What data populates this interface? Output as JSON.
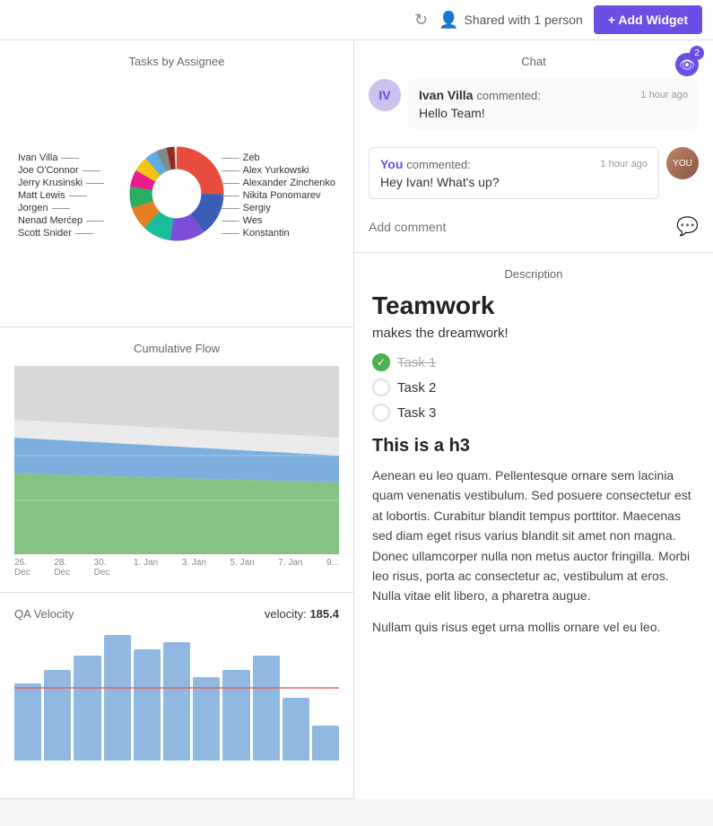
{
  "header": {
    "shared_label": "Shared with 1 person",
    "add_widget_label": "+ Add Widget"
  },
  "tasks_by_assignee": {
    "title": "Tasks by Assignee",
    "labels_left": [
      "Ivan Villa",
      "Joe O'Connor",
      "Jerry Krusinski",
      "Matt Lewis",
      "Jorgen",
      "Nenad Merćep",
      "Scott Snider"
    ],
    "labels_right": [
      "Zeb",
      "Alex Yurkowski",
      "Alexander Zinchenko",
      "Nikita Ponomarev",
      "Sergiy",
      "Wes",
      "Konstantin"
    ]
  },
  "cumulative_flow": {
    "title": "Cumulative Flow",
    "x_labels": [
      "26.\nDec",
      "28.\nDec",
      "30.\nDec",
      "1. Jan",
      "3. Jan",
      "5. Jan",
      "7. Jan",
      "9..."
    ]
  },
  "qa_velocity": {
    "title": "QA Velocity",
    "velocity_label": "velocity:",
    "velocity_value": "185.4",
    "bar_heights": [
      55,
      65,
      75,
      90,
      80,
      85,
      60,
      65,
      75,
      45,
      25
    ],
    "avg_line_pct": 55
  },
  "chat": {
    "title": "Chat",
    "eye_count": "2",
    "messages": [
      {
        "author": "Ivan Villa",
        "time": "1 hour ago",
        "text": "Hello Team!"
      }
    ],
    "you_message": {
      "author": "You",
      "commented": "commented:",
      "time": "1 hour ago",
      "text": "Hey Ivan! What's up?"
    },
    "add_comment_placeholder": "Add comment"
  },
  "description": {
    "label": "Description",
    "title": "Teamwork",
    "subtitle": "makes the dreamwork!",
    "tasks": [
      {
        "label": "Task 1",
        "done": true
      },
      {
        "label": "Task 2",
        "done": false
      },
      {
        "label": "Task 3",
        "done": false
      }
    ],
    "h3": "This is a h3",
    "body1": "Aenean eu leo quam. Pellentesque ornare sem lacinia quam venenatis vestibulum. Sed posuere consectetur est at lobortis. Curabitur blandit tempus porttitor. Maecenas sed diam eget risus varius blandit sit amet non magna. Donec ullamcorper nulla non metus auctor fringilla. Morbi leo risus, porta ac consectetur ac, vestibulum at eros. Nulla vitae elit libero, a pharetra augue.",
    "body2": "Nullam quis risus eget urna mollis ornare vel eu leo."
  }
}
